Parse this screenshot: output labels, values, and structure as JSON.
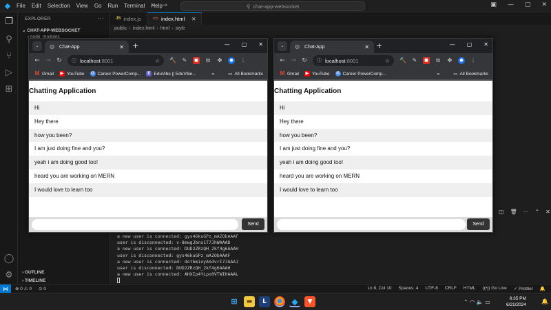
{
  "vscode": {
    "menu": [
      "File",
      "Edit",
      "Selection",
      "View",
      "Go",
      "Run",
      "Terminal",
      "Help"
    ],
    "search_text": "chat-app-websocket",
    "explorer_title": "EXPLORER",
    "folder": "CHAT-APP-WEBSOCKET",
    "sidebar_file": "node_modules",
    "outline": "OUTLINE",
    "timeline": "TIMELINE",
    "tabs": [
      {
        "icon": "JS",
        "label": "index.js"
      },
      {
        "icon": "<>",
        "label": "index.html"
      }
    ],
    "breadcrumbs": [
      "public",
      "index.html",
      "html",
      "style"
    ],
    "terminal_lines": [
      "a new user is connected: gys46kuGPz_mAZObAAAF",
      "user is disconnected: v-8mwgJbns1T7JhWAAAD",
      "a new user is connected: DUD2ZRzQH_2kf4g6AAAH",
      "user is disconnected: gys46kuGPz_mAZObAAAF",
      "a new user is connected: dotbmioyASdvrI7JAAAJ",
      "user is disconnected: DUD2ZRzQH_2kf4g6AAAH",
      "a new user is connected: AHXIp4YLpo0VTWIHAAAL"
    ],
    "status": {
      "errors": "0",
      "warnings": "0",
      "ports": "0",
      "position": "Ln 8, Col 10",
      "spaces": "Spaces: 4",
      "encoding": "UTF-8",
      "eol": "CRLF",
      "language": "HTML",
      "golive": "Go Live",
      "prettier": "Prettier"
    }
  },
  "taskbar": {
    "time": "8:35 PM",
    "date": "6/21/2024"
  },
  "chrome_left": {
    "tab_title": "Chat-App",
    "url_host": "localhost",
    "url_port": ":8001",
    "bookmarks": [
      "Gmail",
      "YouTube",
      "Career PowerComp...",
      "EduVibe || EduVibe..."
    ],
    "all_bookmarks": "All Bookmarks",
    "page_title": "Chatting Application",
    "messages": [
      "Hi",
      "Hey there",
      "how you been?",
      "I am just doing fine and you?",
      "yeah i am doing good too!",
      "heard you are working on MERN",
      "I would love to learn too"
    ],
    "input_value": "",
    "send_label": "Send"
  },
  "chrome_right": {
    "tab_title": "Chat-App",
    "url_host": "localhost",
    "url_port": ":8001",
    "bookmarks": [
      "Gmail",
      "YouTube",
      "Career PowerComp..."
    ],
    "all_bookmarks": "All Bookmarks",
    "page_title": "Chatting Application",
    "messages": [
      "Hi",
      "Hey there",
      "how you been?",
      "I am just doing fine and you?",
      "yeah i am doing good too!",
      "heard you are working on MERN",
      "I would love to learn too"
    ],
    "input_value": "",
    "send_label": "Send"
  },
  "colors": {
    "vscode_bg": "#1e1e1e",
    "accent_blue": "#0078d4",
    "send_button": "#333333",
    "chrome_frame": "#202124"
  }
}
